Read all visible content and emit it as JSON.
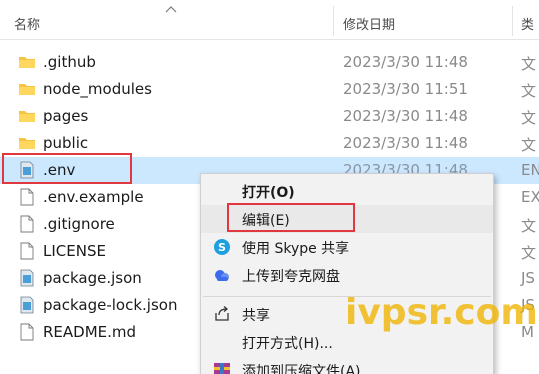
{
  "header": {
    "name_label": "名称",
    "date_label": "修改日期",
    "type_label": "类"
  },
  "files": [
    {
      "name": ".github",
      "date": "2023/3/30 11:48",
      "type": "文",
      "icon": "folder-icon"
    },
    {
      "name": "node_modules",
      "date": "2023/3/30 11:51",
      "type": "文",
      "icon": "folder-icon"
    },
    {
      "name": "pages",
      "date": "2023/3/30 11:48",
      "type": "文",
      "icon": "folder-icon"
    },
    {
      "name": "public",
      "date": "2023/3/30 11:48",
      "type": "文",
      "icon": "folder-icon"
    },
    {
      "name": ".env",
      "date": "2023/3/30 11:48",
      "type": "EN",
      "icon": "settings-file-icon",
      "selected": true
    },
    {
      "name": ".env.example",
      "date": "",
      "type": "EX",
      "icon": "file-icon"
    },
    {
      "name": ".gitignore",
      "date": "",
      "type": "文",
      "icon": "file-icon"
    },
    {
      "name": "LICENSE",
      "date": "",
      "type": "文",
      "icon": "file-icon"
    },
    {
      "name": "package.json",
      "date": "",
      "type": "JS",
      "icon": "settings-file-icon"
    },
    {
      "name": "package-lock.json",
      "date": "",
      "type": "JS",
      "icon": "settings-file-icon"
    },
    {
      "name": "README.md",
      "date": "",
      "type": "M",
      "icon": "file-icon"
    }
  ],
  "context_menu": {
    "open": "打开(O)",
    "edit": "编辑(E)",
    "skype_share": "使用 Skype 共享",
    "upload_quark": "上传到夸克网盘",
    "share": "共享",
    "open_with": "打开方式(H)...",
    "add_to_archive": "添加到压缩文件(A)..."
  },
  "watermark": "ivpsr.com",
  "colors": {
    "selection": "#cce8ff",
    "highlight_border": "#e0383e",
    "folder": "#f6c342",
    "watermark": "#f0b400"
  }
}
